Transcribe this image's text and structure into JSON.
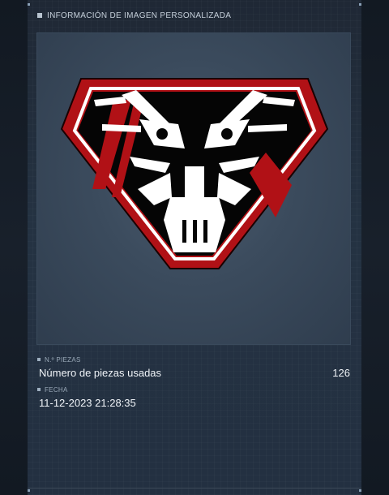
{
  "header": {
    "title": "INFORMACIÓN DE IMAGEN PERSONALIZADA"
  },
  "emblem": {
    "icon": "dragon-skull-emblem-icon",
    "colors": {
      "outer": "#b11116",
      "border": "#ffffff",
      "fill": "#000000",
      "art": "#ffffff"
    }
  },
  "pieces": {
    "label": "N.º PIEZAS",
    "description": "Número de piezas usadas",
    "value": "126"
  },
  "date": {
    "label": "FECHA",
    "value": "11-12-2023 21:28:35"
  }
}
